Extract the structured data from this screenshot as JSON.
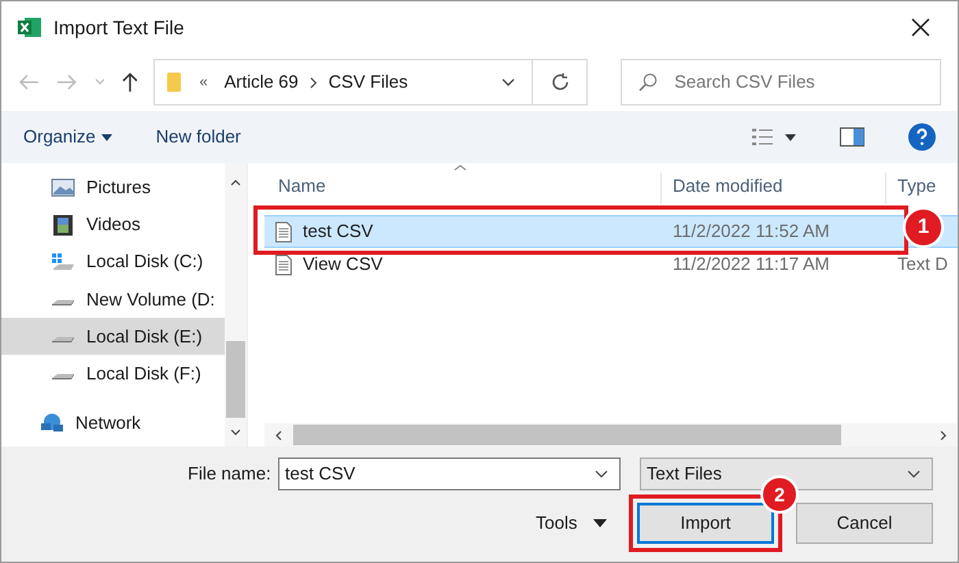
{
  "window": {
    "title": "Import Text File"
  },
  "address": {
    "crumbs": [
      "Article 69",
      "CSV Files"
    ],
    "overflow": "«"
  },
  "search": {
    "placeholder": "Search CSV Files"
  },
  "toolbar": {
    "organize": "Organize",
    "new_folder": "New folder"
  },
  "sidebar": {
    "items": [
      {
        "label": "Pictures",
        "kind": "pictures",
        "selected": false
      },
      {
        "label": "Videos",
        "kind": "videos",
        "selected": false
      },
      {
        "label": "Local Disk (C:)",
        "kind": "system-disk",
        "selected": false
      },
      {
        "label": "New Volume (D:",
        "kind": "disk",
        "selected": false
      },
      {
        "label": "Local Disk (E:)",
        "kind": "disk",
        "selected": true
      },
      {
        "label": "Local Disk (F:)",
        "kind": "disk",
        "selected": false
      },
      {
        "label": "Network",
        "kind": "network",
        "selected": false
      }
    ]
  },
  "table": {
    "columns": [
      "Name",
      "Date modified",
      "Type"
    ],
    "rows": [
      {
        "name": "test CSV",
        "date": "11/2/2022 11:52 AM",
        "selected": true,
        "callout": "1"
      },
      {
        "name": "View CSV",
        "date": "11/2/2022 11:17 AM",
        "type": "Text D",
        "selected": false
      }
    ]
  },
  "file_name": {
    "label": "File name:",
    "value": "test CSV"
  },
  "file_type": {
    "value": "Text Files"
  },
  "tools": "Tools",
  "buttons": [
    {
      "label": "Import",
      "kind": "primary",
      "callout": "2"
    },
    {
      "label": "Cancel",
      "kind": "normal"
    }
  ]
}
